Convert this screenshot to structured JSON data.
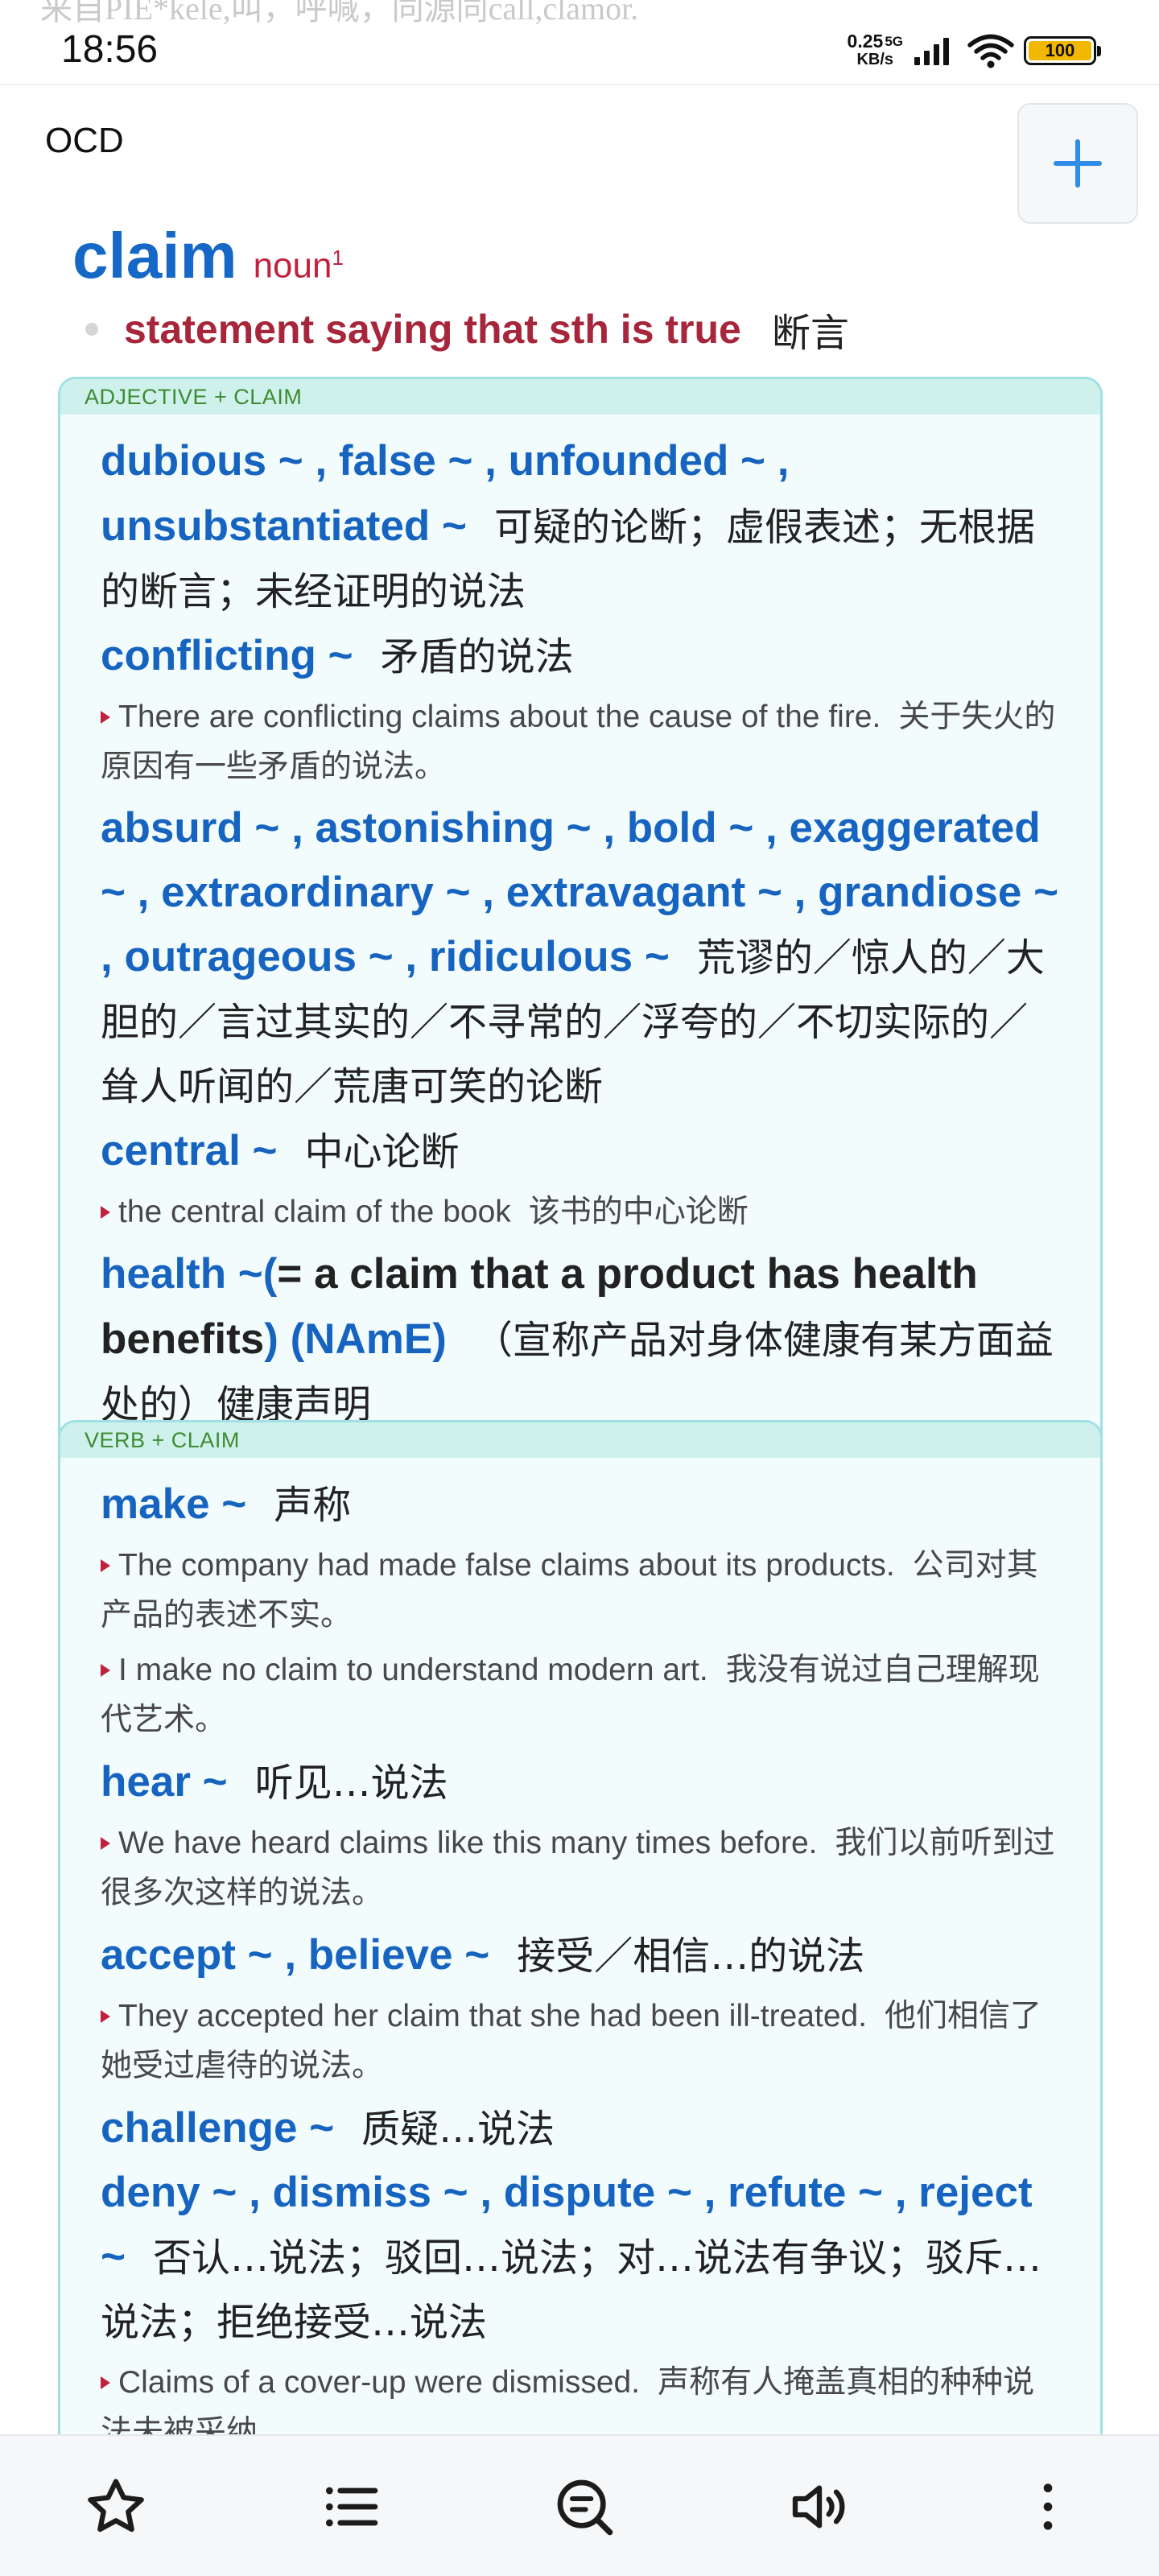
{
  "page_top_bleed": "来自PIE*kele,叫，呼喊，同源同call,clamor.",
  "status_bar": {
    "time": "18:56",
    "net_speed_value": "0.25",
    "net_speed_unit": "KB/s",
    "network": "5G",
    "battery": "100",
    "battery_color": "#f2b800"
  },
  "header": {
    "dictionary": "OCD",
    "add_icon": "plus-icon"
  },
  "entry": {
    "headword": "claim",
    "pos": "noun",
    "pos_sup": "1",
    "sense": "statement saying that sth is true",
    "sense_zh": "断言"
  },
  "adjective_box": {
    "title": "ADJECTIVE + CLAIM",
    "c1_col": "dubious ~ , false ~ , unfounded ~ , unsubstantiated ~",
    "c1_zh": "可疑的论断；虚假表述；无根据的断言；未经证明的说法",
    "c2_col": "conflicting ~",
    "c2_zh": "矛盾的说法",
    "c2_ex_en": "There are conflicting claims about the cause of the fire.",
    "c2_ex_zh": "关于失火的原因有一些矛盾的说法。",
    "c3_col": "absurd ~ , astonishing ~ , bold ~ , exaggerated ~ , extraordinary ~ , extravagant ~ , grandiose ~ , outrageous ~ , ridiculous ~",
    "c3_zh": "荒谬的／惊人的／大胆的／言过其实的／不寻常的／浮夸的／不切实际的／耸人听闻的／荒唐可笑的论断",
    "c4_col": "central ~",
    "c4_zh": "中心论断",
    "c4_ex_en": "the central claim of the book",
    "c4_ex_zh": "该书的中心论断",
    "c5_col_a": "health ~(",
    "c5_def": "= a claim that a product has health benefits",
    "c5_col_b": ") (NAmE)",
    "c5_zh": "（宣称产品对身体健康有某方面益处的）健康声明"
  },
  "verb_box": {
    "title": "VERB + CLAIM",
    "v1_col": "make ~",
    "v1_zh": "声称",
    "v1_ex1_en": "The company had made false claims about its products.",
    "v1_ex1_zh": "公司对其产品的表述不实。",
    "v1_ex2_en": "I make no claim to understand modern art.",
    "v1_ex2_zh": "我没有说过自己理解现代艺术。",
    "v2_col": "hear ~",
    "v2_zh": "听见…说法",
    "v2_ex_en": "We have heard claims like this many times before.",
    "v2_ex_zh": "我们以前听到过很多次这样的说法。",
    "v3_col": "accept ~ , believe ~",
    "v3_zh": "接受／相信…的说法",
    "v3_ex_en": "They accepted her claim that she had been ill-treated.",
    "v3_ex_zh": "他们相信了她受过虐待的说法。",
    "v4_col": "challenge ~",
    "v4_zh": "质疑…说法",
    "v5_col": "deny ~ , dismiss ~ , dispute ~ , refute ~ , reject ~",
    "v5_zh": "否认…说法；驳回…说法；对…说法有争议；驳斥…说法；拒绝接受…说法",
    "v5_ex_en": "Claims of a cover-up were dismissed.",
    "v5_ex_zh": "声称有人掩盖真相的种种说法未被采纳。"
  },
  "bottom_bar": {
    "icons": [
      "star-icon",
      "list-icon",
      "search-chat-icon",
      "speaker-icon",
      "more-vertical-icon"
    ]
  },
  "colors": {
    "accent_blue": "#1668c6",
    "pos_red": "#c0223d",
    "box_border": "#9fe0e6",
    "box_header": "#cff1ec",
    "box_header_text": "#3d8b32"
  }
}
